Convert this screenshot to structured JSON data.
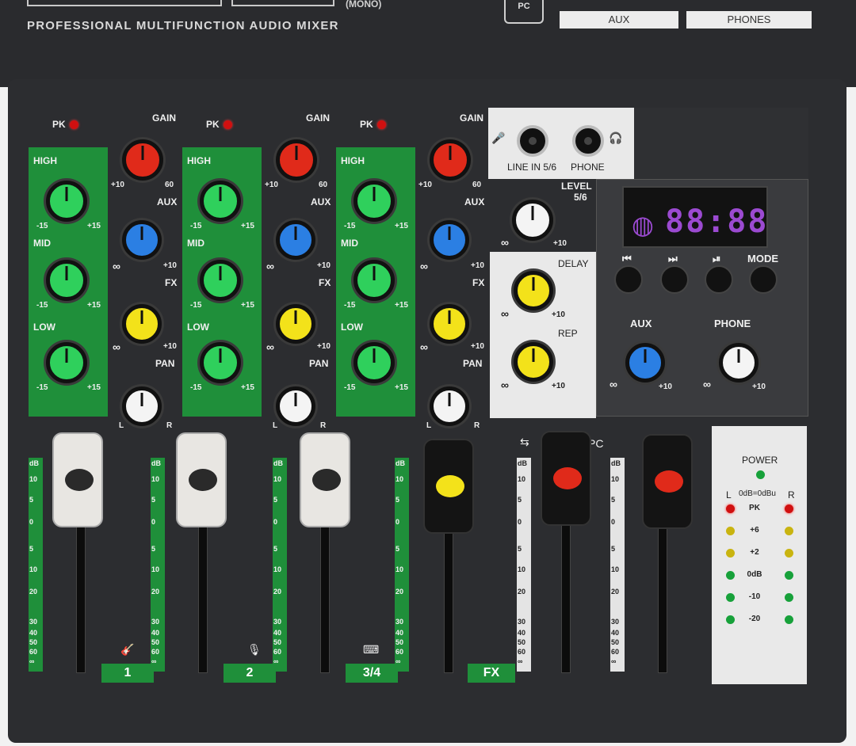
{
  "header": {
    "brand": "PROFESSIONAL MULTIFUNCTION AUDIO MIXER",
    "mono_label": "(MONO)",
    "pc_badge": "PC",
    "aux_label": "AUX",
    "phones_label": "PHONES"
  },
  "channels": [
    {
      "id": "1",
      "label": "1",
      "icon": "guitar-mic-icon",
      "fader_color": "white"
    },
    {
      "id": "2",
      "label": "2",
      "icon": "mic-icon",
      "fader_color": "white"
    },
    {
      "id": "3",
      "label": "3/4",
      "icon": "keyboard-icon",
      "fader_color": "white"
    }
  ],
  "knob_labels": {
    "pk": "PK",
    "gain": "GAIN",
    "high": "HIGH",
    "mid": "MID",
    "low": "LOW",
    "aux": "AUX",
    "fx": "FX",
    "pan": "PAN"
  },
  "ticks": {
    "eq_min": "-15",
    "eq_max": "+15",
    "gain_min": "+10",
    "gain_max": "60",
    "send_min": "∞",
    "send_max": "+10",
    "pan_l": "L",
    "pan_r": "R"
  },
  "fader_scale": [
    "dB",
    "10",
    "5",
    "0",
    "5",
    "10",
    "20",
    "30",
    "40",
    "50",
    "60",
    "∞"
  ],
  "fx_channel": {
    "label": "FX"
  },
  "input_panel": {
    "line_in": "LINE IN 5/6",
    "phone": "PHONE",
    "level": "LEVEL",
    "level_sub": "5/6",
    "delay": "DELAY",
    "rep": "REP"
  },
  "player": {
    "display": "88:88",
    "prev_label": "⏮",
    "next_label": "⏭",
    "play_label": "⏯",
    "mode_label": "MODE",
    "aux_label": "AUX",
    "phone_label": "PHONE"
  },
  "usb_label": "PC",
  "meter": {
    "power": "POWER",
    "l": "L",
    "ref": "0dB=0dBu",
    "r": "R",
    "rows": [
      {
        "label": "PK",
        "color": "red"
      },
      {
        "label": "+6",
        "color": "yellow"
      },
      {
        "label": "+2",
        "color": "yellow"
      },
      {
        "label": "0dB",
        "color": "green"
      },
      {
        "label": "-10",
        "color": "green"
      },
      {
        "label": "-20",
        "color": "green"
      }
    ]
  }
}
